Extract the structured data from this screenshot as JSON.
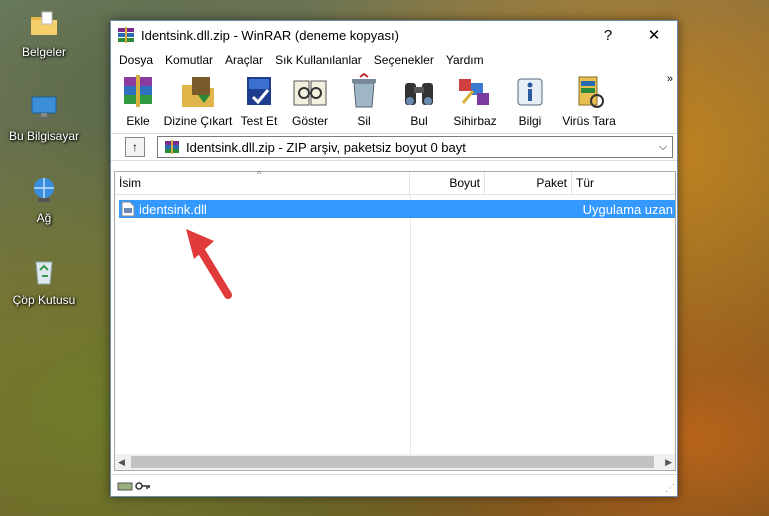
{
  "desktop": {
    "icons": [
      {
        "label": "Belgeler"
      },
      {
        "label": "Bu Bilgisayar"
      },
      {
        "label": "Ağ"
      },
      {
        "label": "Çöp Kutusu"
      }
    ]
  },
  "window": {
    "title": "Identsink.dll.zip - WinRAR (deneme kopyası)",
    "help_btn": "?",
    "close_btn": "✕",
    "menu": [
      "Dosya",
      "Komutlar",
      "Araçlar",
      "Sık Kullanılanlar",
      "Seçenekler",
      "Yardım"
    ],
    "toolbar": [
      {
        "label": "Ekle",
        "icon": "add-icon"
      },
      {
        "label": "Dizine Çıkart",
        "icon": "extract-icon"
      },
      {
        "label": "Test Et",
        "icon": "test-icon"
      },
      {
        "label": "Göster",
        "icon": "view-icon"
      },
      {
        "label": "Sil",
        "icon": "delete-icon"
      },
      {
        "label": "Bul",
        "icon": "find-icon"
      },
      {
        "label": "Sihirbaz",
        "icon": "wizard-icon"
      },
      {
        "label": "Bilgi",
        "icon": "info-icon"
      },
      {
        "label": "Virüs Tara",
        "icon": "virus-scan-icon"
      }
    ],
    "toolbar_more": "»",
    "address": "Identsink.dll.zip - ZIP arşiv, paketsiz boyut 0 bayt",
    "columns": {
      "name": "İsim",
      "size": "Boyut",
      "packed": "Paket",
      "type": "Tür"
    },
    "files": [
      {
        "name": "identsink.dll",
        "size": "",
        "packed": "",
        "type": "Uygulama uzan"
      }
    ]
  },
  "colors": {
    "selection": "#3399ff",
    "arrow": "#e03a3a"
  }
}
